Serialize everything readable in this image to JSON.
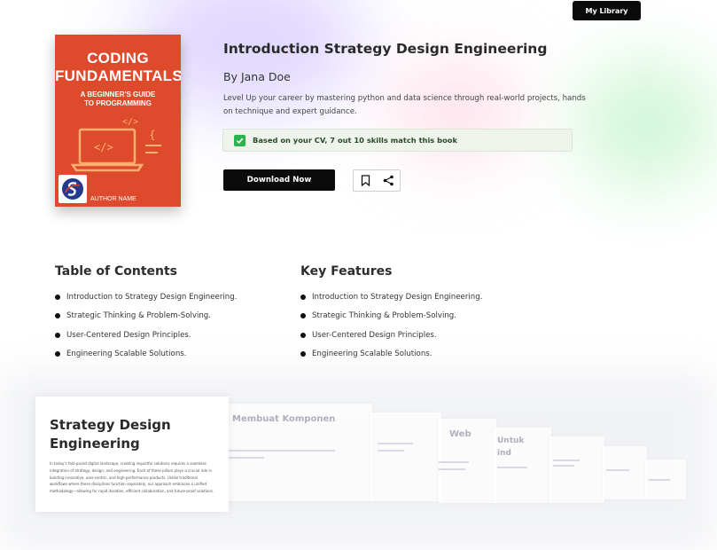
{
  "header": {
    "library_label": "My Library"
  },
  "book": {
    "cover": {
      "title_line1": "CODING",
      "title_line2": "FUNDAMENTALS",
      "subtitle_line1": "A BEGINNER'S GUIDE",
      "subtitle_line2": "TO PROGRAMMING",
      "author": "AUTHOR NAME",
      "bg_color": "#de4a2c"
    },
    "title": "Introduction Strategy Design Engineering",
    "author": "By Jana Doe",
    "description": "Level Up your career by mastering python and data science through real-world projects, hands on technique and expert guidance.",
    "match_text": "Based on your CV, 7 out 10 skills match this book",
    "download_label": "Download Now",
    "icons": {
      "bookmark": "bookmark-icon",
      "share": "share-icon"
    }
  },
  "toc": {
    "heading": "Table of Contents",
    "items": [
      "Introduction to Strategy Design Engineering.",
      "Strategic Thinking & Problem-Solving.",
      "User-Centered Design Principles.",
      "Engineering Scalable Solutions."
    ]
  },
  "features": {
    "heading": "Key Features",
    "items": [
      "Introduction to Strategy Design Engineering.",
      "Strategic Thinking & Problem-Solving.",
      "User-Centered Design Principles.",
      "Engineering Scalable Solutions."
    ]
  },
  "preview": {
    "title_line1": "Strategy Design",
    "title_line2": "Engineering",
    "body": "In today's fast-paced digital landscape, creating impactful solutions requires a seamless integration of strategy, design, and engineering. Each of these pillars plays a crucial role in building innovative, user-centric, and high-performance products. Unlike traditional workflows where these disciplines function separately, our approach embraces a unified methodology—allowing for rapid iteration, efficient collaboration, and future-proof solutions.",
    "ghost_title_1": "Membuat Komponen",
    "ghost_title_2": "Web",
    "ghost_title_3": "Untuk",
    "ghost_title_3b": "ind"
  }
}
